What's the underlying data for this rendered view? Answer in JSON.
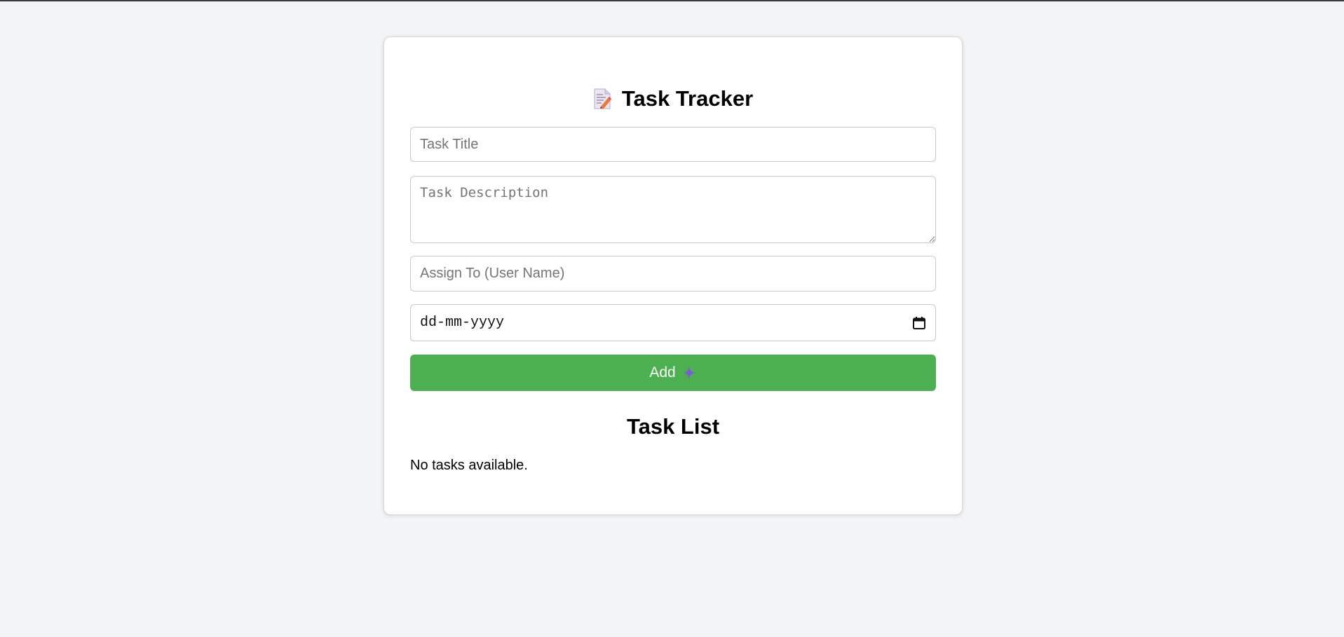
{
  "app": {
    "title": "Task Tracker",
    "title_icon": "memo-icon"
  },
  "form": {
    "title_placeholder": "Task Title",
    "title_value": "",
    "description_placeholder": "Task Description",
    "description_value": "",
    "assignee_placeholder": "Assign To (User Name)",
    "assignee_value": "",
    "date_placeholder": "dd-mm-yyyy",
    "date_icon": "calendar-icon",
    "add_label": "Add",
    "add_icon": "plus-icon"
  },
  "task_list": {
    "heading": "Task List",
    "empty_message": "No tasks available.",
    "items": []
  },
  "colors": {
    "page_background": "#f3f4f6",
    "card_background": "#ffffff",
    "button": "#4caf50",
    "button_text": "#ffffff",
    "plus_icon": "#7b5cd6"
  }
}
